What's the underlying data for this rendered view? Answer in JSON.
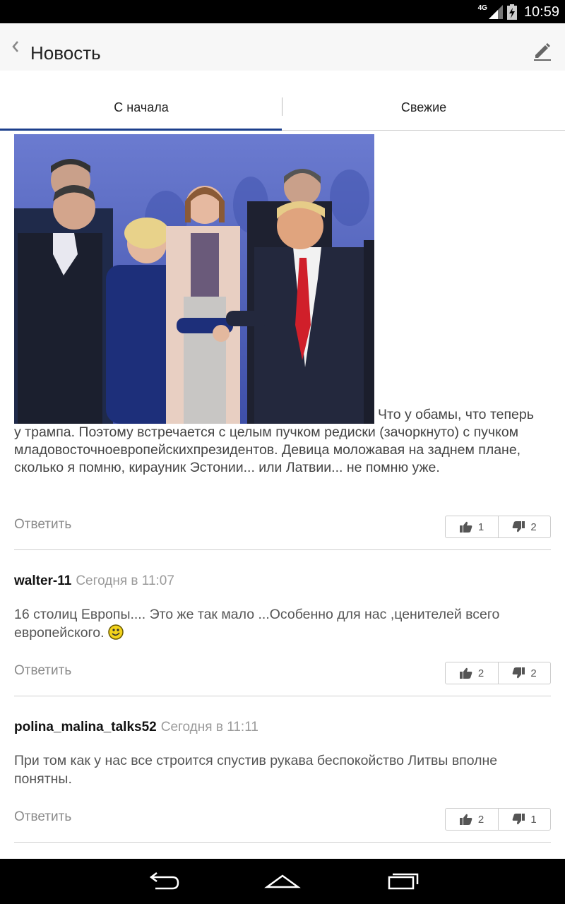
{
  "status_bar": {
    "network": "4G",
    "time": "10:59"
  },
  "app_bar": {
    "title": "Новость"
  },
  "tabs": [
    {
      "label": "С начала",
      "active": true
    },
    {
      "label": "Свежие",
      "active": false
    }
  ],
  "post": {
    "text_first_line": "Что у обамы, что теперь",
    "text_rest": "у трампа. Поэтому встречается с целым пучком редиски (зачоркнуто) с пучком младовосточноевропейскихпрезидентов. Девица моложавая на заднем плане, сколько я помню, кирауник Эстонии... или Латвии... не помню уже.",
    "reply_label": "Ответить",
    "likes": "1",
    "dislikes": "2"
  },
  "comments": [
    {
      "author": "walter-11",
      "time": "Сегодня в 11:07",
      "text": "16 столиц Европы.... Это же так мало ...Особенно для нас ,ценителей всего европейского.",
      "reply_label": "Ответить",
      "likes": "2",
      "dislikes": "2"
    },
    {
      "author": "polina_malina_talks52",
      "time": "Сегодня в 11:11",
      "text": "При том как у нас все строится спустив рукава беспокойство Литвы вполне понятны.",
      "reply_label": "Ответить",
      "likes": "2",
      "dislikes": "1"
    }
  ],
  "colors": {
    "accent": "#1c3f8c",
    "photo_background": "#5a6bbd"
  },
  "icons": [
    "back-icon",
    "edit-icon",
    "thumbs-up-icon",
    "thumbs-down-icon",
    "smiley-icon",
    "nav-back-icon",
    "nav-home-icon",
    "nav-recents-icon"
  ]
}
